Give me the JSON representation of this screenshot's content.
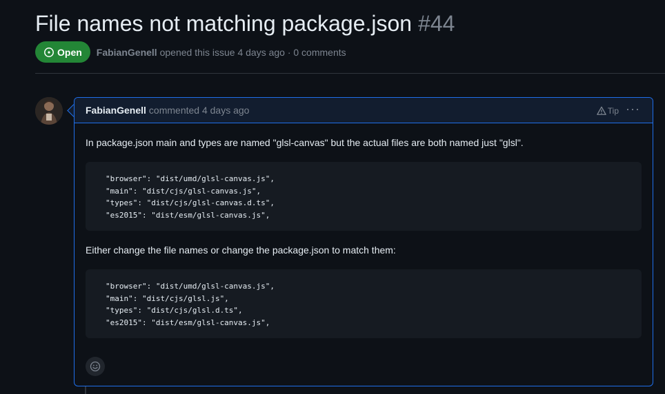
{
  "issue": {
    "title": "File names not matching package.json",
    "number": "#44",
    "state": "Open",
    "author": "FabianGenell",
    "meta_text": "opened this issue 4 days ago · 0 comments"
  },
  "comment": {
    "author": "FabianGenell",
    "action": "commented 4 days ago",
    "tip_label": "Tip",
    "menu_label": "···",
    "paragraph_1": "In package.json main and types are named \"glsl-canvas\" but the actual files are both named just \"glsl\".",
    "code_1": [
      "\"browser\": \"dist/umd/glsl-canvas.js\",",
      "\"main\": \"dist/cjs/glsl-canvas.js\",",
      "\"types\": \"dist/cjs/glsl-canvas.d.ts\",",
      "\"es2015\": \"dist/esm/glsl-canvas.js\","
    ],
    "paragraph_2": "Either change the file names or change the package.json to match them:",
    "code_2": [
      "\"browser\": \"dist/umd/glsl-canvas.js\",",
      "\"main\": \"dist/cjs/glsl.js\",",
      "\"types\": \"dist/cjs/glsl.d.ts\",",
      "\"es2015\": \"dist/esm/glsl-canvas.js\","
    ]
  },
  "icons": {
    "state": "issue-opened-icon",
    "tip": "alert-icon",
    "reaction": "smiley-icon",
    "menu": "kebab-horizontal-icon"
  },
  "colors": {
    "background": "#0d1117",
    "open_badge": "#238636",
    "accent_border": "#1f6feb",
    "muted_text": "#7d8590",
    "code_background": "#161b22"
  }
}
